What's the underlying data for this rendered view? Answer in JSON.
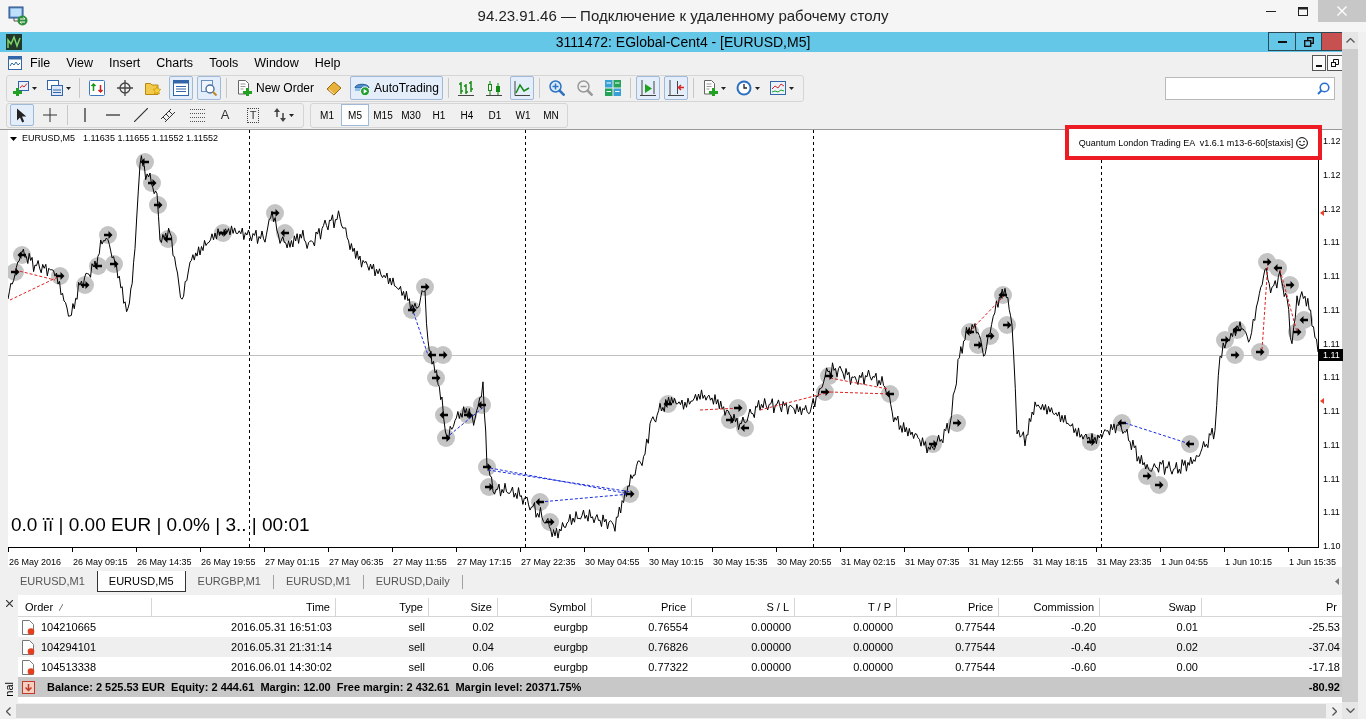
{
  "remote_window": {
    "title": "94.23.91.46 — Подключение к удаленному рабочему столу"
  },
  "app_window": {
    "title": "3111472: EGlobal-Cent4 - [EURUSD,M5]"
  },
  "menu": [
    "File",
    "View",
    "Insert",
    "Charts",
    "Tools",
    "Window",
    "Help"
  ],
  "main_toolbar": [
    {
      "pressed": false
    },
    {
      "pressed": false
    },
    {
      "pressed": false
    },
    {
      "pressed": false
    },
    {
      "pressed": false
    },
    {
      "pressed": true
    },
    {
      "pressed": true
    },
    {
      "label": "New Order",
      "pressed": false
    },
    {
      "pressed": false
    },
    {
      "label": "AutoTrading",
      "pressed": true
    },
    {
      "pressed": false
    },
    {
      "pressed": false
    },
    {
      "pressed": true
    },
    {
      "pressed": false
    },
    {
      "pressed": false
    },
    {
      "pressed": false
    },
    {
      "pressed": true
    },
    {
      "pressed": true
    },
    {
      "pressed": false
    },
    {
      "pressed": false
    },
    {
      "pressed": false
    }
  ],
  "drawing_toolbar": [
    {
      "pressed": true
    },
    {
      "pressed": false
    },
    {
      "pressed": false
    },
    {
      "pressed": false
    },
    {
      "pressed": false
    },
    {
      "pressed": false
    },
    {
      "pressed": false
    },
    {
      "label": "A",
      "pressed": false
    },
    {
      "label": "T",
      "pressed": false
    },
    {
      "pressed": false
    }
  ],
  "timeframes": [
    {
      "label": "M1",
      "selected": false
    },
    {
      "label": "M5",
      "selected": true
    },
    {
      "label": "M15",
      "selected": false
    },
    {
      "label": "M30",
      "selected": false
    },
    {
      "label": "H1",
      "selected": false
    },
    {
      "label": "H4",
      "selected": false
    },
    {
      "label": "D1",
      "selected": false
    },
    {
      "label": "W1",
      "selected": false
    },
    {
      "label": "MN",
      "selected": false
    }
  ],
  "chart": {
    "symbol": "EURUSD,M5",
    "prices": "1.11635 1.11655 1.11552 1.11552",
    "expert": "Quantum London Trading EA  v1.6.1 m13-6-60[staxis]",
    "stats": "0.0 ïï | 0.00 EUR | 0.0% | 3.. | 00:01",
    "price_axis": [
      "1.12",
      "1.12",
      "1.12",
      "1.11",
      "1.11",
      "1.11",
      "1.11",
      "1.11",
      "1.11",
      "1.11",
      "1.11",
      "1.11",
      "1.10"
    ],
    "current_price": "1.11",
    "time_axis": [
      "26 May 2016",
      "26 May 09:15",
      "26 May 14:35",
      "26 May 19:55",
      "27 May 01:15",
      "27 May 06:35",
      "27 May 11:55",
      "27 May 17:15",
      "27 May 22:35",
      "30 May 04:55",
      "30 May 10:15",
      "30 May 15:35",
      "30 May 20:55",
      "31 May 02:15",
      "31 May 07:35",
      "31 May 12:55",
      "31 May 18:15",
      "31 May 23:35",
      "1 Jun 04:55",
      "1 Jun 10:15",
      "1 Jun 15:35"
    ]
  },
  "chart_tabs": [
    {
      "label": "EURUSD,M1",
      "selected": false
    },
    {
      "label": "EURUSD,M5",
      "selected": true
    },
    {
      "label": "EURGBP,M1",
      "selected": false
    },
    {
      "label": "EURUSD,M1",
      "selected": false
    },
    {
      "label": "EURUSD,Daily",
      "selected": false
    }
  ],
  "terminal": {
    "panel_label": "nal",
    "columns": [
      "Order",
      "Time",
      "Type",
      "Size",
      "Symbol",
      "Price",
      "S / L",
      "T / P",
      "Price",
      "Commission",
      "Swap",
      "Pr"
    ],
    "rows": [
      [
        "104210665",
        "2016.05.31 16:51:03",
        "sell",
        "0.02",
        "eurgbp",
        "0.76554",
        "0.00000",
        "0.00000",
        "0.77544",
        "-0.20",
        "0.01",
        "-25.53"
      ],
      [
        "104294101",
        "2016.05.31 21:31:14",
        "sell",
        "0.04",
        "eurgbp",
        "0.76826",
        "0.00000",
        "0.00000",
        "0.77544",
        "-0.40",
        "0.02",
        "-37.04"
      ],
      [
        "104513338",
        "2016.06.01 14:30:02",
        "sell",
        "0.06",
        "eurgbp",
        "0.77322",
        "0.00000",
        "0.00000",
        "0.77544",
        "-0.60",
        "0.00",
        "-17.18"
      ]
    ],
    "summary": {
      "text": "Balance: 2 525.53 EUR  Equity: 2 444.61  Margin: 12.00  Free margin: 2 432.61  Margin level: 20371.75%",
      "profit": "-80.92"
    }
  }
}
